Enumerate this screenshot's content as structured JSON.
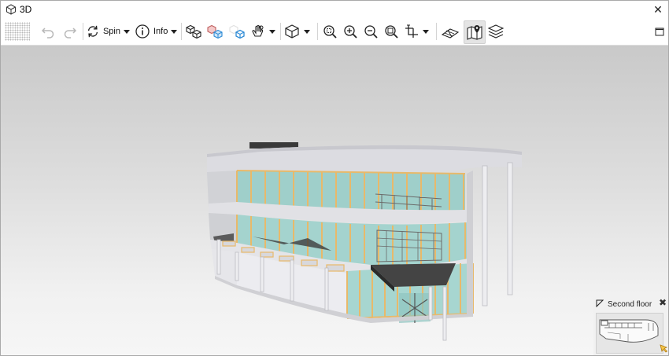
{
  "window": {
    "title": "3D",
    "close_glyph": "✕"
  },
  "toolbar": {
    "grip_icon": "toolbar-grip-icon",
    "undo_icon": "undo-icon",
    "redo_icon": "redo-icon",
    "spin": {
      "label": "Spin",
      "icon": "spin-icon"
    },
    "info": {
      "label": "Info",
      "icon": "info-icon"
    },
    "select_all_icon": "select-boxes-icon",
    "select_related_icon": "select-related-boxes-icon",
    "select_hidden_icon": "select-hidden-box-icon",
    "isolate_icon": "hand-isolate-icon",
    "view_cube_icon": "view-cube-icon",
    "zoom_fit_icon": "zoom-fit-icon",
    "zoom_in_icon": "zoom-in-icon",
    "zoom_out_icon": "zoom-out-icon",
    "zoom_window_icon": "zoom-window-icon",
    "measure_icon": "measure-icon",
    "floor_plan_icon": "floor-plan-icon",
    "map_icon": "map-pin-icon",
    "layers_icon": "layers-icon",
    "maximize_icon": "maximize-icon"
  },
  "minimap": {
    "label": "Second floor",
    "close_glyph": "✖"
  },
  "colors": {
    "accent": "#2e8bd6",
    "glass": "#9fd0cc",
    "frame": "#e8b96a"
  }
}
